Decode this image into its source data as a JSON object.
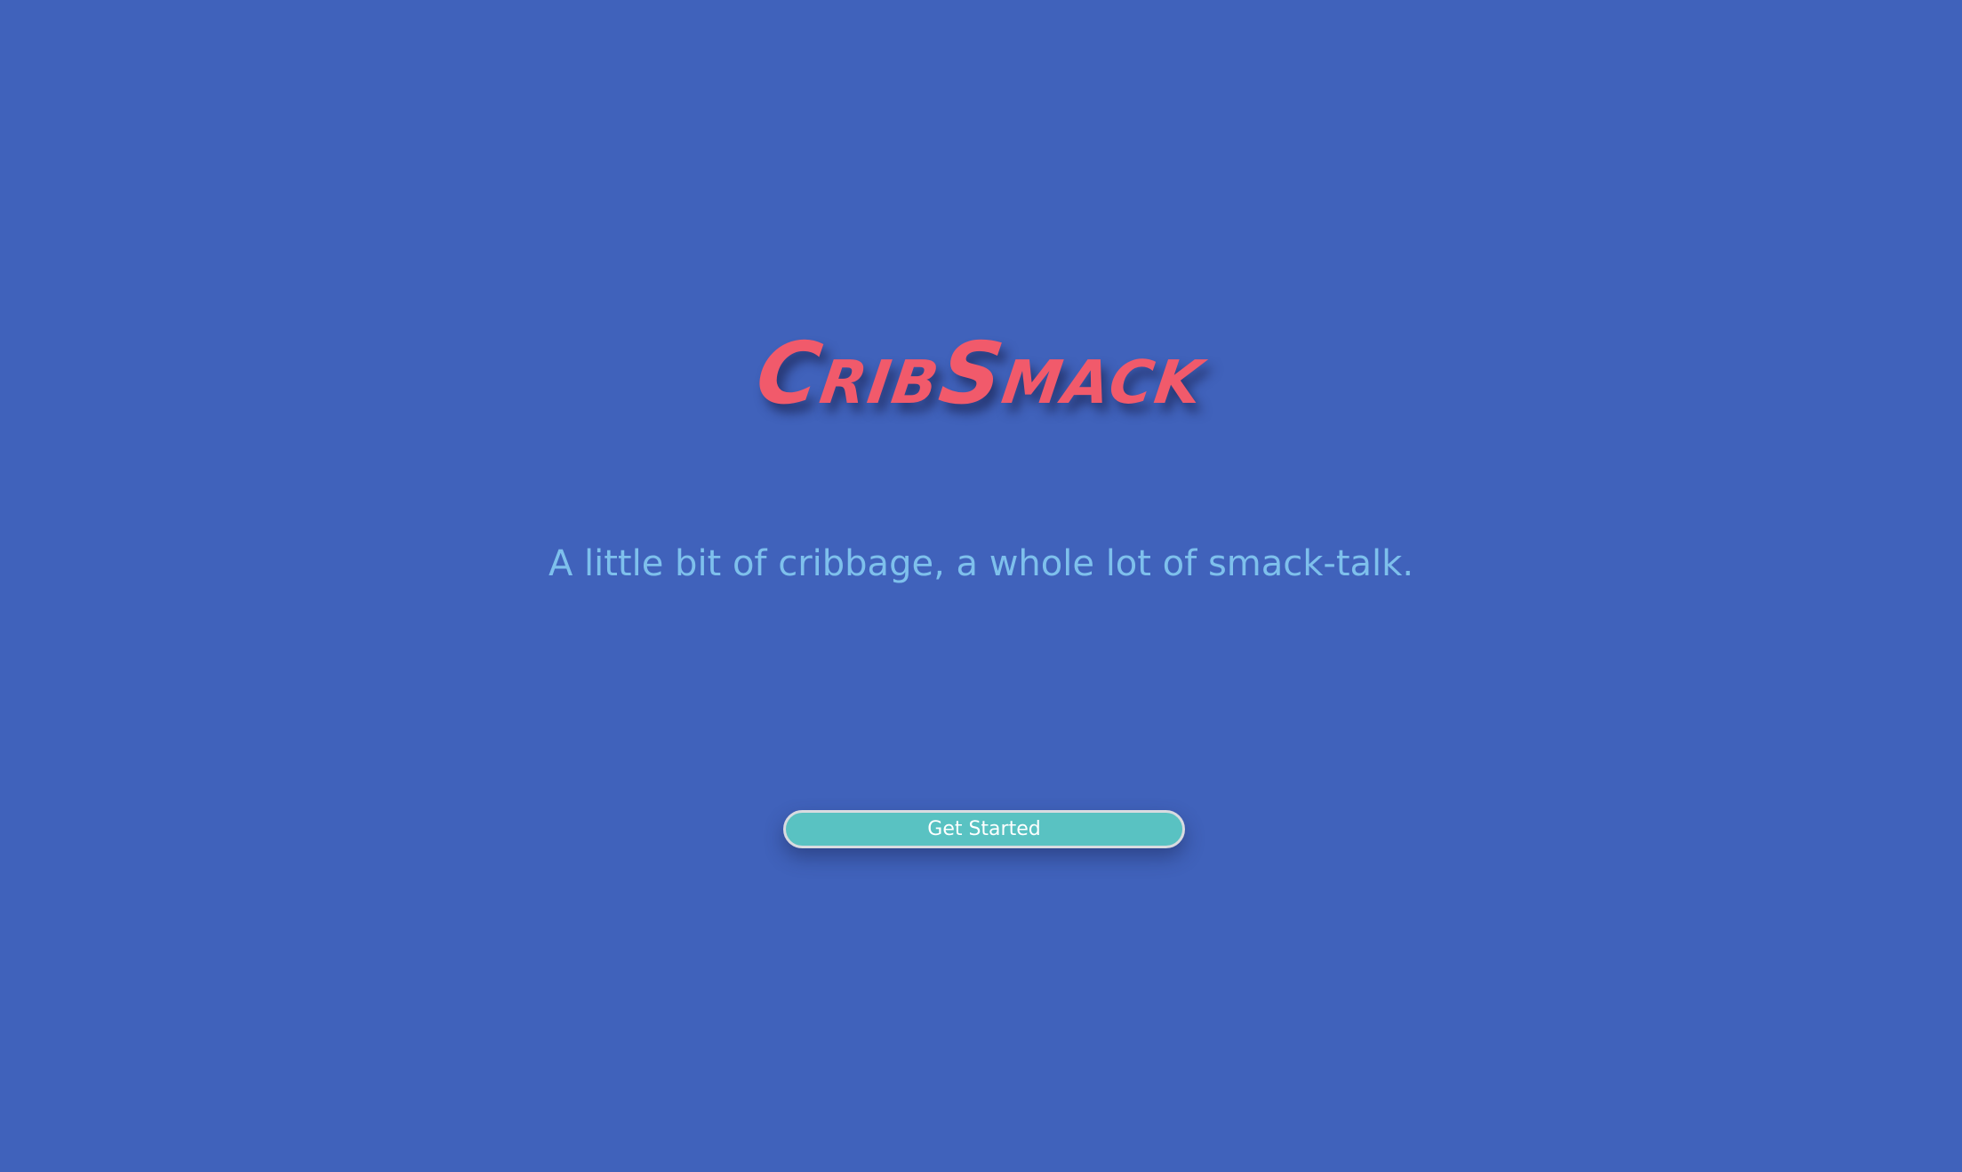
{
  "app": {
    "logo_text": "CribSmack",
    "tagline": "A little bit of cribbage, a whole lot of smack-talk.",
    "cta_label": "Get Started"
  },
  "colors": {
    "background": "#4062bb",
    "logo": "#f15a6b",
    "tagline": "#7ec0ec",
    "button": "#59c2c2",
    "button_text": "#ffffff"
  }
}
